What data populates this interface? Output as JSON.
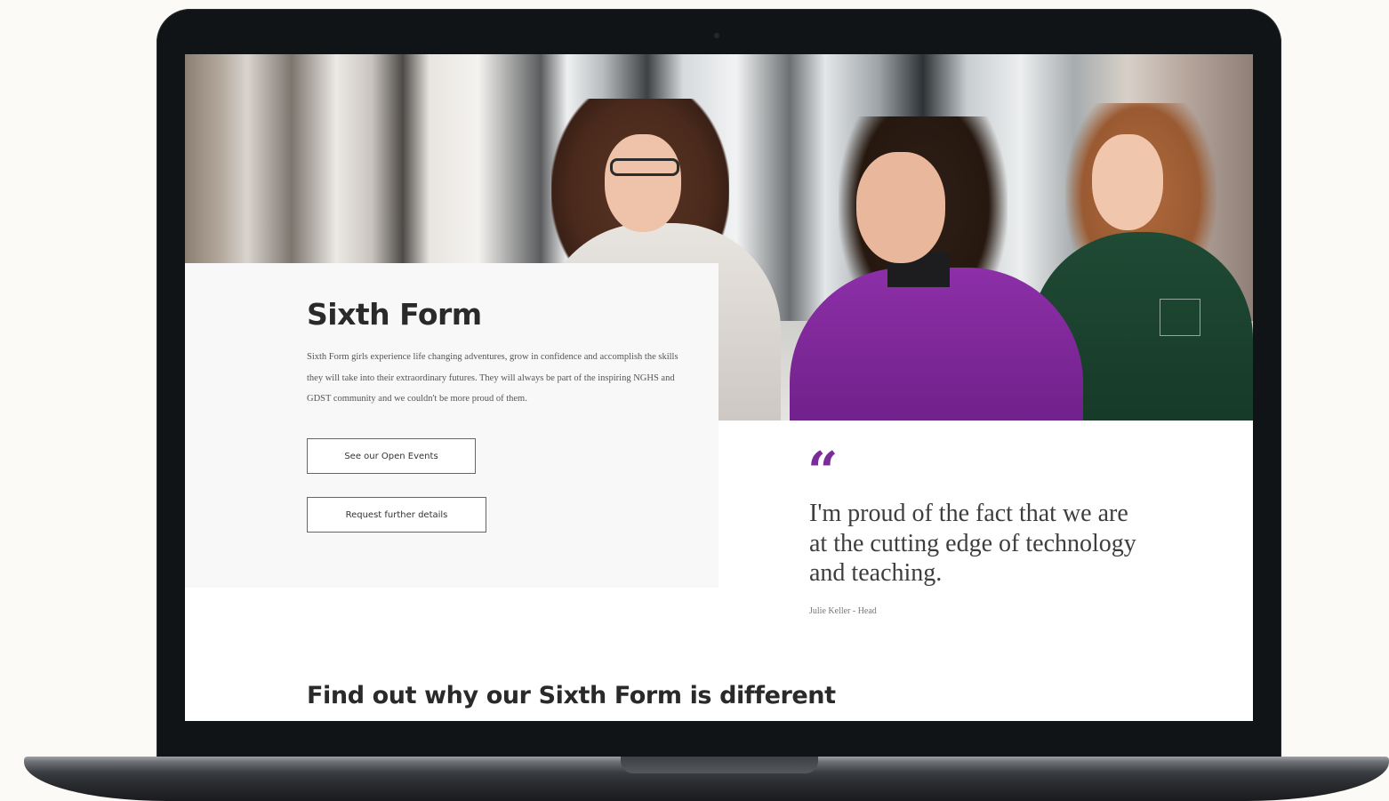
{
  "hero": {
    "title": "Sixth Form",
    "intro": "Sixth Form girls experience life changing adventures, grow in confidence and accomplish the skills they will take into their extraordinary futures. They will always be part of the inspiring NGHS and GDST community and we couldn't be more proud of them.",
    "buttons": {
      "open_events": "See our Open Events",
      "further_details": "Request further details"
    }
  },
  "quote": {
    "mark": "“",
    "text": "I'm proud of the fact that we are at the cutting edge of technology and teaching.",
    "author": "Julie Keller - Head"
  },
  "section": {
    "heading": "Find out why our Sixth Form is different"
  },
  "colors": {
    "accent": "#7b2b9a",
    "laptop_frame": "#111416"
  }
}
